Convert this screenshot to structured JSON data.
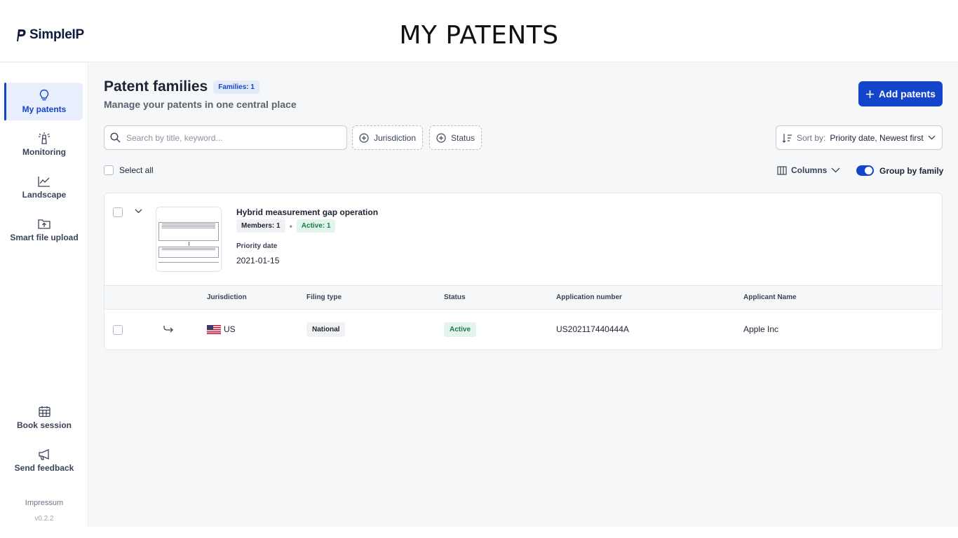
{
  "header": {
    "logo_text": "SimpleIP",
    "page_heading": "MY PATENTS"
  },
  "sidebar": {
    "items": [
      {
        "label": "My patents",
        "icon": "lightbulb-icon",
        "active": true
      },
      {
        "label": "Monitoring",
        "icon": "lighthouse-icon",
        "active": false
      },
      {
        "label": "Landscape",
        "icon": "chart-line-icon",
        "active": false
      },
      {
        "label": "Smart file upload",
        "icon": "folder-upload-icon",
        "active": false
      }
    ],
    "bottom_items": [
      {
        "label": "Book session",
        "icon": "calendar-icon"
      },
      {
        "label": "Send feedback",
        "icon": "megaphone-icon"
      }
    ],
    "impressum": "Impressum",
    "version": "v0.2.2"
  },
  "main": {
    "title": "Patent families",
    "families_badge": "Families: 1",
    "subtitle": "Manage your patents in one central place",
    "add_button": "Add patents",
    "search_placeholder": "Search by title, keyword...",
    "filters": [
      "Jurisdiction",
      "Status"
    ],
    "sort_label": "Sort by:",
    "sort_value": "Priority date, Newest first",
    "select_all": "Select all",
    "columns_label": "Columns",
    "group_by_family": "Group by family",
    "group_by_family_enabled": true
  },
  "family": {
    "title": "Hybrid measurement gap operation",
    "members": "Members: 1",
    "active": "Active: 1",
    "priority_label": "Priority date",
    "priority_date": "2021-01-15",
    "table": {
      "headers": [
        "Jurisdiction",
        "Filing type",
        "Status",
        "Application number",
        "Applicant Name"
      ],
      "rows": [
        {
          "jurisdiction": "US",
          "filing_type": "National",
          "status": "Active",
          "application_number": "US202117440444A",
          "applicant": "Apple Inc"
        }
      ]
    }
  },
  "colors": {
    "accent": "#1444c9",
    "active_green": "#1a7a4c"
  }
}
